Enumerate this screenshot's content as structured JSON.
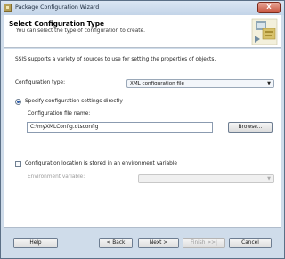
{
  "window": {
    "title": "Package Configuration Wizard",
    "close_glyph": "X"
  },
  "header": {
    "title": "Select Configuration Type",
    "subtitle": "You can select the type of configuration to create."
  },
  "content": {
    "intro": "SSIS supports a variety of sources to use for setting the properties of objects.",
    "config_type_label": "Configuration type:",
    "config_type_value": "XML configuration file",
    "option_direct_label": "Specify configuration settings directly",
    "config_file_label": "Configuration file name:",
    "config_file_value": "C:\\myXMLConfig.dtsconfig",
    "browse_label": "Browse...",
    "option_env_label": "Configuration location is stored in an environment variable",
    "env_var_label": "Environment variable:",
    "env_var_value": ""
  },
  "footer": {
    "help": "Help",
    "back": "< Back",
    "next": "Next >",
    "finish": "Finish >>|",
    "cancel": "Cancel"
  }
}
